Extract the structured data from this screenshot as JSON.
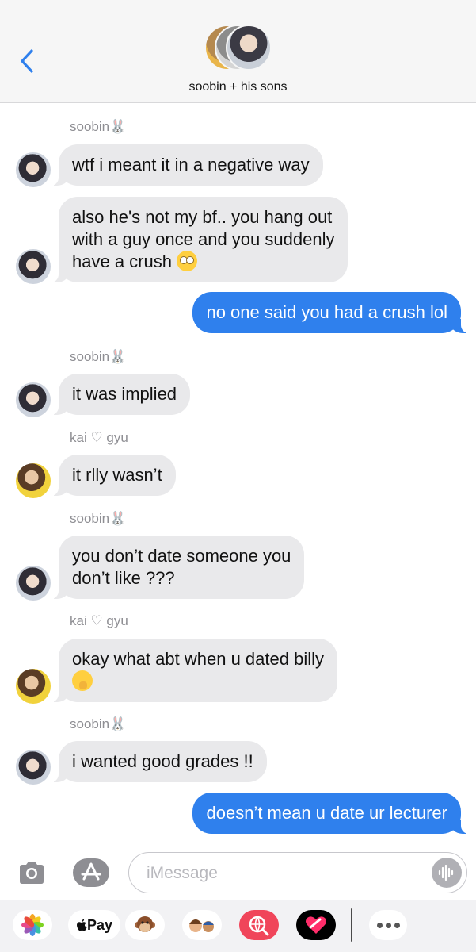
{
  "header": {
    "group_name": "soobin + his sons"
  },
  "messages": [
    {
      "sender": "soobin🐰",
      "text": "wtf i meant it in a negative way"
    },
    {
      "text": "also he's not my bf.. you hang out\nwith a guy once and you suddenly\nhave a crush "
    },
    {
      "text": "no one said you had a crush lol"
    },
    {
      "sender": "soobin🐰",
      "text": "it was implied"
    },
    {
      "sender": "kai ♡ gyu",
      "text": "it rlly wasn’t"
    },
    {
      "sender": "soobin🐰",
      "text": "you don’t date someone you\ndon’t like ???"
    },
    {
      "sender": "kai ♡ gyu",
      "text": "okay what abt when u dated billy\n"
    },
    {
      "sender": "soobin🐰",
      "text": "i wanted good grades !!"
    },
    {
      "text": "doesn’t mean u date ur lecturer"
    }
  ],
  "input": {
    "placeholder": "iMessage"
  },
  "drawer": {
    "pay_label": "Pay",
    "apps": [
      "photos-app-icon",
      "apple-pay-app",
      "animoji-monkey-app",
      "memoji-app",
      "web-search-app",
      "fitness-heart-app",
      "more-apps"
    ]
  },
  "colors": {
    "outgoing": "#2f80ed",
    "incoming": "#e9e9eb",
    "header_bg": "#f6f6f6"
  }
}
